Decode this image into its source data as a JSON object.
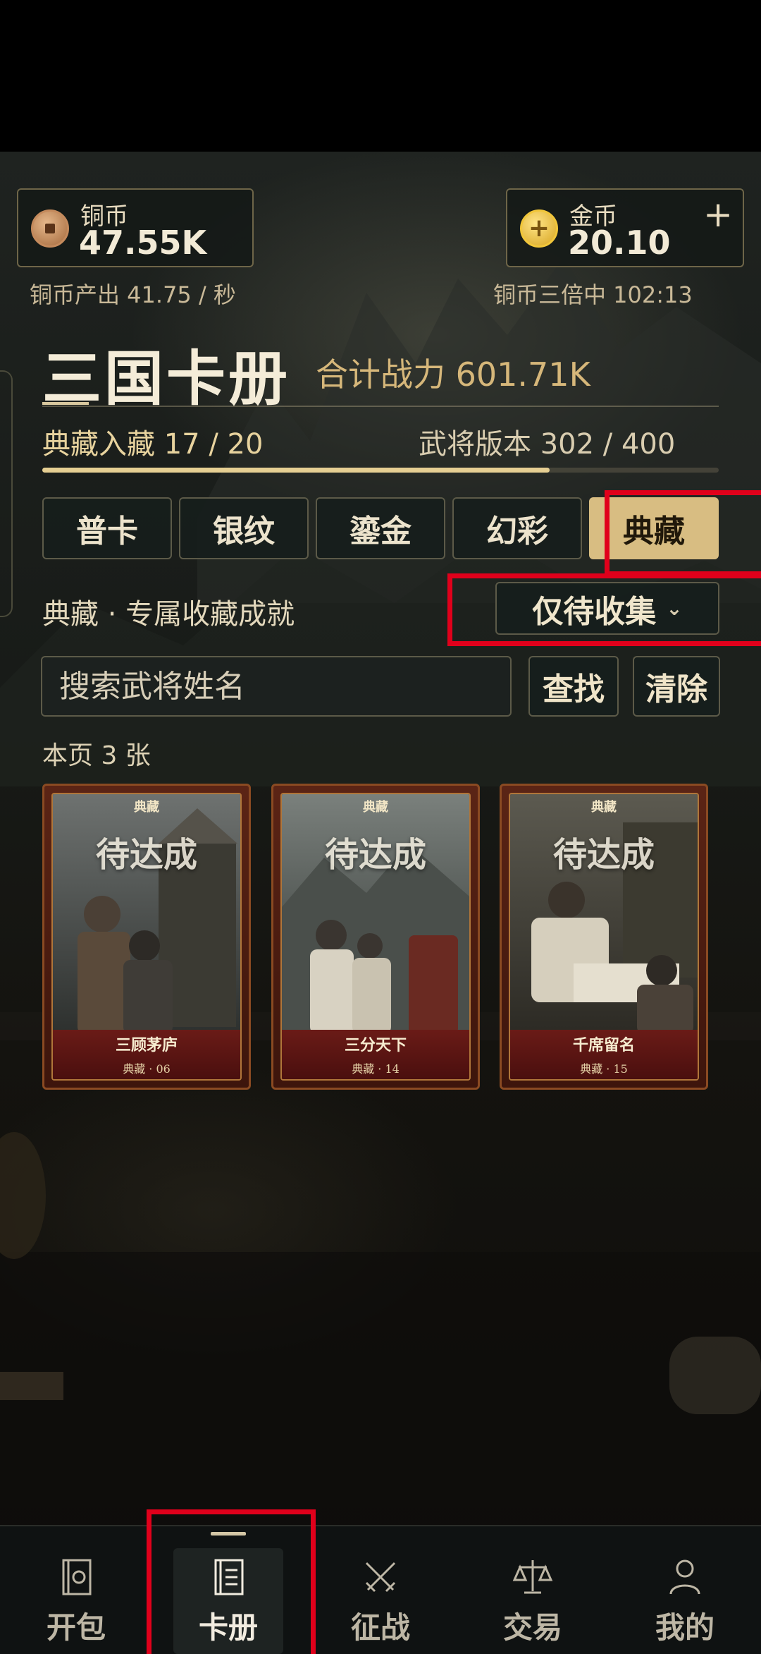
{
  "currency": {
    "copper": {
      "label": "铜币",
      "value": "47.55K",
      "icon": "copper-coin-icon"
    },
    "gold": {
      "label": "金币",
      "value": "20.10",
      "icon": "gold-coin-icon",
      "add": "+"
    },
    "copper_rate": "铜币产出 41.75 / 秒",
    "copper_boost": "铜币三倍中 102:13"
  },
  "header": {
    "title": "三国卡册",
    "power": "合计战力 601.71K",
    "collect_progress": "典藏入藏 17 / 20",
    "version_progress": "武将版本 302 / 400",
    "progress_fraction": 0.75
  },
  "tabs": [
    {
      "label": "普卡",
      "active": false
    },
    {
      "label": "银纹",
      "active": false
    },
    {
      "label": "鎏金",
      "active": false
    },
    {
      "label": "幻彩",
      "active": false
    },
    {
      "label": "典藏",
      "active": true
    }
  ],
  "section": {
    "label": "典藏 · 专属收藏成就",
    "filter": "仅待收集",
    "filter_icon": "chevron-down-icon"
  },
  "search": {
    "placeholder": "搜索武将姓名",
    "find": "查找",
    "clear": "清除"
  },
  "page_count": "本页 3 张",
  "cards": [
    {
      "tag": "典藏",
      "status": "待达成",
      "name": "三顾茅庐",
      "number": "典藏 · 06"
    },
    {
      "tag": "典藏",
      "status": "待达成",
      "name": "三分天下",
      "number": "典藏 · 14"
    },
    {
      "tag": "典藏",
      "status": "待达成",
      "name": "千席留名",
      "number": "典藏 · 15"
    }
  ],
  "nav": [
    {
      "label": "开包",
      "icon": "pack-icon",
      "active": false
    },
    {
      "label": "卡册",
      "icon": "album-icon",
      "active": true
    },
    {
      "label": "征战",
      "icon": "crossed-swords-icon",
      "active": false
    },
    {
      "label": "交易",
      "icon": "scales-icon",
      "active": false
    },
    {
      "label": "我的",
      "icon": "user-icon",
      "active": false
    }
  ],
  "colors": {
    "accent": "#d8bd82",
    "highlight": "#e0001b",
    "card_frame": "#5b2415"
  }
}
